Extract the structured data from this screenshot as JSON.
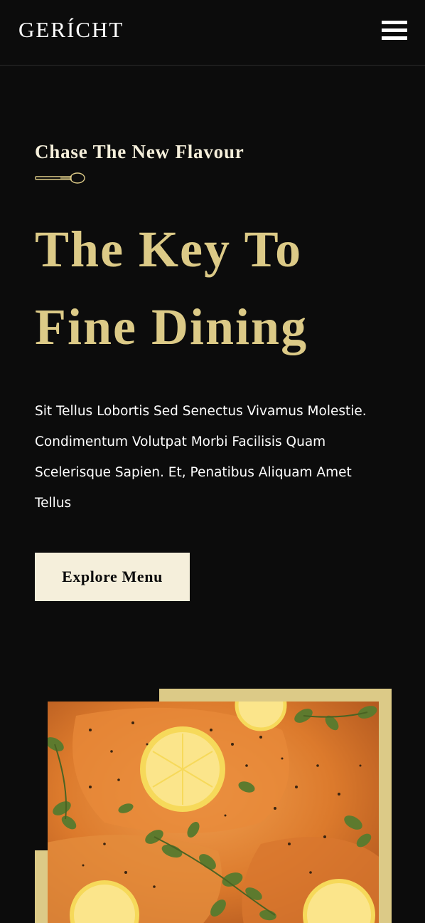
{
  "navbar": {
    "logo": "GERÍCHT",
    "menu_icon": "hamburger-menu-icon"
  },
  "hero": {
    "subtitle": "Chase The New Flavour",
    "divider_icon": "spoon-icon",
    "headline_line1": "The Key To",
    "headline_line2": "Fine Dining",
    "description": "Sit Tellus Lobortis Sed Senectus Vivamus Molestie. Condimentum Volutpat Morbi Facilisis Quam Scelerisque Sapien. Et, Penatibus Aliquam Amet Tellus",
    "button_label": "Explore Menu"
  },
  "colors": {
    "background": "#0c0c0c",
    "gold": "#dcca87",
    "crimson": "#f5efdb",
    "white": "#ffffff"
  }
}
